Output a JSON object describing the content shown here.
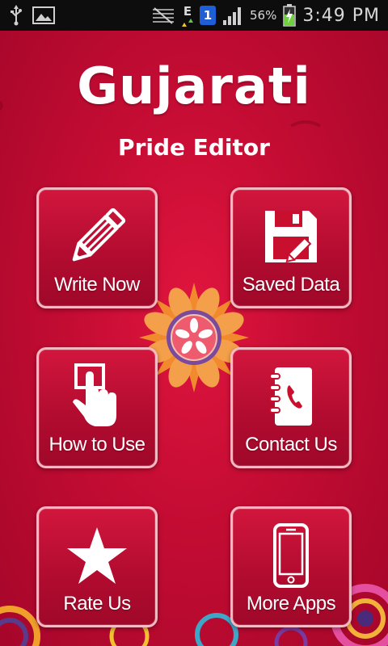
{
  "status_bar": {
    "icons": [
      "usb-icon",
      "image-icon",
      "mute-icon",
      "edge-data-icon",
      "notification-badge-icon",
      "signal-icon",
      "battery-charging-icon"
    ],
    "notification_badge": "1",
    "network_label": "E",
    "battery_percent": "56%",
    "time": "3:49 PM"
  },
  "header": {
    "title": "Gujarati",
    "subtitle": "Pride Editor"
  },
  "tiles": [
    {
      "label": "Write Now",
      "icon": "pencil-icon"
    },
    {
      "label": "Saved Data",
      "icon": "floppy-disk-icon"
    },
    {
      "label": "How to Use",
      "icon": "touch-hand-icon"
    },
    {
      "label": "Contact Us",
      "icon": "phone-book-icon"
    },
    {
      "label": "Rate Us",
      "icon": "star-icon"
    },
    {
      "label": "More Apps",
      "icon": "smartphone-icon"
    }
  ],
  "colors": {
    "background": "#c40c33",
    "tile_border": "#ffd7dc",
    "text": "#ffffff",
    "flower_orange": "#f0802a",
    "flower_purple": "#7b4a9c"
  }
}
